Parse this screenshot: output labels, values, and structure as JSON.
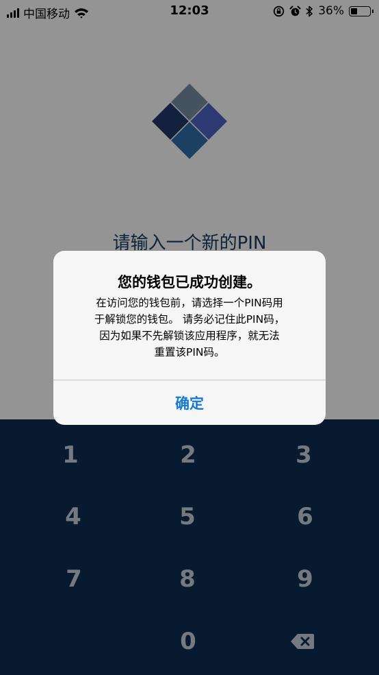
{
  "status_bar": {
    "carrier": "中国移动",
    "time": "12:03",
    "battery_percent": "36%",
    "battery_level": 0.36
  },
  "screen": {
    "title": "请输入一个新的PIN"
  },
  "alert": {
    "title": "您的钱包已成功创建。",
    "message_lines": [
      "在访问您的钱包前，请选择一个PIN码用",
      "于解锁您的钱包。 请务必记住此PIN码，",
      "因为如果不先解锁该应用程序，就无法",
      "重置该PIN码。"
    ],
    "button": "确定"
  },
  "keypad": {
    "keys": [
      "1",
      "2",
      "3",
      "4",
      "5",
      "6",
      "7",
      "8",
      "9",
      "0"
    ],
    "delete_icon": "backspace-icon"
  },
  "colors": {
    "keypad_bg": "#0f2d52",
    "accent": "#1477d4",
    "title": "#1a3b66"
  }
}
